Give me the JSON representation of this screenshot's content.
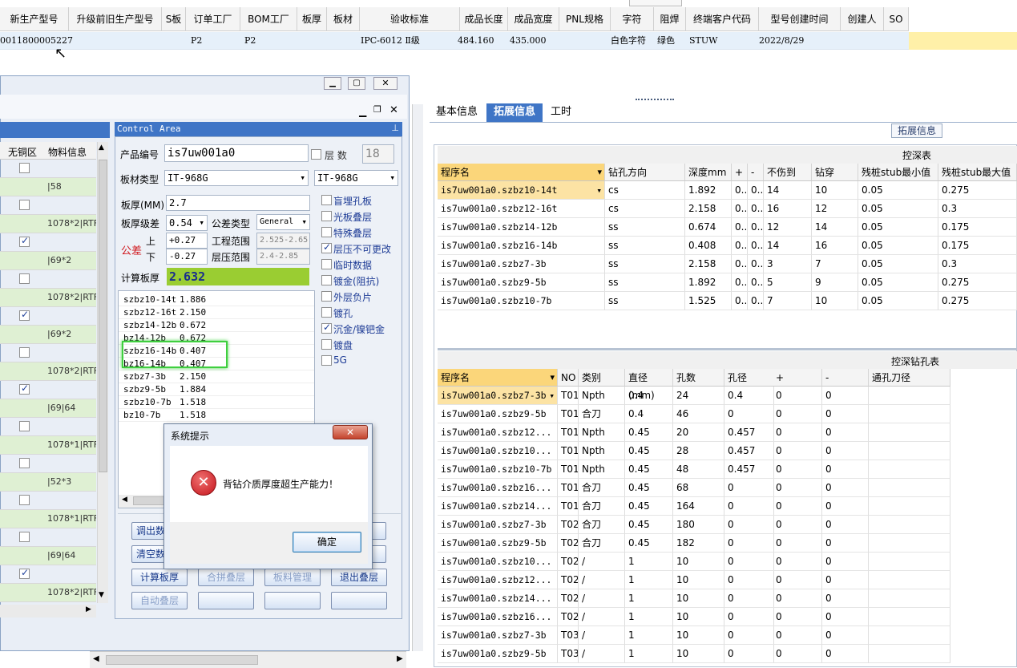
{
  "top_grid": {
    "headers": [
      "新生产型号",
      "升级前旧生产型号",
      "S板",
      "订单工厂",
      "BOM工厂",
      "板厚",
      "板材",
      "验收标准",
      "成品长度",
      "成品宽度",
      "PNL规格",
      "字符",
      "阻焊",
      "终端客户代码",
      "型号创建时间",
      "创建人",
      "SO"
    ],
    "row": {
      "model": "0011800005227",
      "s_board": "",
      "order_factory": "P2",
      "bom_factory": "P2",
      "thickness": "",
      "material": "",
      "standard": "IPC-6012 Ⅱ级",
      "length": "484.160",
      "width": "435.000",
      "pnl": "",
      "char": "白色字符",
      "mask": "绿色",
      "customer": "STUW",
      "created": "2022/8/29",
      "creator": "",
      "so": ""
    }
  },
  "left_list": {
    "headers": [
      "无铜区",
      "物料信息"
    ],
    "rows": [
      {
        "checked": false,
        "info": ""
      },
      {
        "checked": false,
        "info": "|58"
      },
      {
        "checked": false,
        "info": ""
      },
      {
        "checked": false,
        "info": "1078*2|RTF"
      },
      {
        "checked": true,
        "info": ""
      },
      {
        "checked": false,
        "info": "|69*2"
      },
      {
        "checked": false,
        "info": ""
      },
      {
        "checked": false,
        "info": "1078*2|RTF"
      },
      {
        "checked": true,
        "info": ""
      },
      {
        "checked": false,
        "info": "|69*2"
      },
      {
        "checked": false,
        "info": ""
      },
      {
        "checked": false,
        "info": "1078*2|RTF"
      },
      {
        "checked": true,
        "info": ""
      },
      {
        "checked": false,
        "info": "|69|64"
      },
      {
        "checked": false,
        "info": ""
      },
      {
        "checked": false,
        "info": "1078*1|RTF"
      },
      {
        "checked": false,
        "info": ""
      },
      {
        "checked": false,
        "info": "|52*3"
      },
      {
        "checked": false,
        "info": ""
      },
      {
        "checked": false,
        "info": "1078*1|RTF"
      },
      {
        "checked": false,
        "info": ""
      },
      {
        "checked": false,
        "info": "|69|64"
      },
      {
        "checked": true,
        "info": ""
      },
      {
        "checked": false,
        "info": "1078*2|RTF"
      }
    ]
  },
  "control_area": {
    "title": "Control Area",
    "product_label": "产品编号",
    "product_value": "is7uw001a0",
    "layers_label": "层 数",
    "layers_value": "18",
    "material_label": "板材类型",
    "material_value": "IT-968G",
    "material_value2": "IT-968G",
    "thickness_label": "板厚(MM)",
    "thickness_value": "2.7",
    "tol_level_label": "板厚级差",
    "tol_level_value": "0.54",
    "tol_type_label": "公差类型",
    "tol_type_value": "General",
    "tol_label": "公差",
    "upper_label": "上",
    "lower_label": "下",
    "upper_value": "+0.27",
    "lower_value": "-0.27",
    "eng_range_label": "工程范围",
    "eng_range_value": "2.525-2.65",
    "press_range_label": "层压范围",
    "press_range_value": "2.4-2.85",
    "calc_label": "计算板厚",
    "calc_value": "2.632",
    "options": [
      {
        "label": "盲埋孔板",
        "checked": false
      },
      {
        "label": "光板叠层",
        "checked": false
      },
      {
        "label": "特殊叠层",
        "checked": false
      },
      {
        "label": "层压不可更改",
        "checked": true
      },
      {
        "label": "临时数据",
        "checked": false
      },
      {
        "label": "镀金(阻抗)",
        "checked": false
      },
      {
        "label": "外层负片",
        "checked": false
      },
      {
        "label": "镀孔",
        "checked": false
      },
      {
        "label": "沉金/镍钯金",
        "checked": true
      },
      {
        "label": "镀盘",
        "checked": false
      },
      {
        "label": "5G",
        "checked": false
      }
    ],
    "list_rows": [
      {
        "name": "szbz10-14t",
        "val": "1.886"
      },
      {
        "name": "szbz12-16t",
        "val": "2.150"
      },
      {
        "name": "szbz14-12b",
        "val": "0.672"
      },
      {
        "name": "bz14-12b",
        "val": "0.672"
      },
      {
        "name": "szbz16-14b",
        "val": "0.407"
      },
      {
        "name": "bz16-14b",
        "val": "0.407"
      },
      {
        "name": "szbz7-3b",
        "val": "2.150"
      },
      {
        "name": "szbz9-5b",
        "val": "1.884"
      },
      {
        "name": "szbz10-7b",
        "val": "1.518"
      },
      {
        "name": "bz10-7b",
        "val": "1.518"
      }
    ],
    "buttons": {
      "export": "调出数",
      "clear": "清空数",
      "calc": "计算板厚",
      "merge": "合拼叠层",
      "material_mgmt": "板料管理",
      "exit": "退出叠层",
      "auto": "自动叠层"
    }
  },
  "dialog": {
    "title": "系统提示",
    "message": "背钻介质厚度超生产能力！",
    "ok": "确定"
  },
  "right_panel": {
    "tabs": [
      "基本信息",
      "拓展信息",
      "工时"
    ],
    "active_tab": "拓展信息",
    "groupbox_label": "拓展信息",
    "depth_table": {
      "caption": "控深表",
      "headers": [
        "程序名",
        "钻孔方向",
        "深度mm",
        "+",
        "-",
        "不伤到",
        "钻穿",
        "残桩stub最小值",
        "残桩stub最大值"
      ],
      "rows": [
        [
          "is7uw001a0.szbz10-14t",
          "cs",
          "1.892",
          "0..",
          "0..",
          "14",
          "10",
          "0.05",
          "0.275"
        ],
        [
          "is7uw001a0.szbz12-16t",
          "cs",
          "2.158",
          "0..",
          "0..",
          "16",
          "12",
          "0.05",
          "0.3"
        ],
        [
          "is7uw001a0.szbz14-12b",
          "ss",
          "0.674",
          "0..",
          "0..",
          "12",
          "14",
          "0.05",
          "0.175"
        ],
        [
          "is7uw001a0.szbz16-14b",
          "ss",
          "0.408",
          "0..",
          "0..",
          "14",
          "16",
          "0.05",
          "0.175"
        ],
        [
          "is7uw001a0.szbz7-3b",
          "ss",
          "2.158",
          "0..",
          "0..",
          "3",
          "7",
          "0.05",
          "0.3"
        ],
        [
          "is7uw001a0.szbz9-5b",
          "ss",
          "1.892",
          "0..",
          "0..",
          "5",
          "9",
          "0.05",
          "0.275"
        ],
        [
          "is7uw001a0.szbz10-7b",
          "ss",
          "1.525",
          "0..",
          "0..",
          "7",
          "10",
          "0.05",
          "0.275"
        ]
      ]
    },
    "hole_table": {
      "caption": "控深钻孔表",
      "headers": [
        "程序名",
        "NO",
        "类别",
        "直径(mm)",
        "孔数",
        "孔径",
        "+",
        "-",
        "通孔刀径"
      ],
      "rows": [
        [
          "is7uw001a0.szbz7-3b",
          "T01",
          "Npth",
          "0.4",
          "24",
          "0.4",
          "0",
          "0",
          ""
        ],
        [
          "is7uw001a0.szbz9-5b",
          "T01",
          "合刀",
          "0.4",
          "46",
          "0",
          "0",
          "0",
          ""
        ],
        [
          "is7uw001a0.szbz12...",
          "T01",
          "Npth",
          "0.45",
          "20",
          "0.457",
          "0",
          "0",
          ""
        ],
        [
          "is7uw001a0.szbz10...",
          "T01",
          "Npth",
          "0.45",
          "28",
          "0.457",
          "0",
          "0",
          ""
        ],
        [
          "is7uw001a0.szbz10-7b",
          "T01",
          "Npth",
          "0.45",
          "48",
          "0.457",
          "0",
          "0",
          ""
        ],
        [
          "is7uw001a0.szbz16...",
          "T01",
          "合刀",
          "0.45",
          "68",
          "0",
          "0",
          "0",
          ""
        ],
        [
          "is7uw001a0.szbz14...",
          "T01",
          "合刀",
          "0.45",
          "164",
          "0",
          "0",
          "0",
          ""
        ],
        [
          "is7uw001a0.szbz7-3b",
          "T02",
          "合刀",
          "0.45",
          "180",
          "0",
          "0",
          "0",
          ""
        ],
        [
          "is7uw001a0.szbz9-5b",
          "T02",
          "合刀",
          "0.45",
          "182",
          "0",
          "0",
          "0",
          ""
        ],
        [
          "is7uw001a0.szbz10...",
          "T02",
          "/",
          "1",
          "10",
          "0",
          "0",
          "0",
          ""
        ],
        [
          "is7uw001a0.szbz12...",
          "T02",
          "/",
          "1",
          "10",
          "0",
          "0",
          "0",
          ""
        ],
        [
          "is7uw001a0.szbz14...",
          "T02",
          "/",
          "1",
          "10",
          "0",
          "0",
          "0",
          ""
        ],
        [
          "is7uw001a0.szbz16...",
          "T02",
          "/",
          "1",
          "10",
          "0",
          "0",
          "0",
          ""
        ],
        [
          "is7uw001a0.szbz7-3b",
          "T03",
          "/",
          "1",
          "10",
          "0",
          "0",
          "0",
          ""
        ],
        [
          "is7uw001a0.szbz9-5b",
          "T03",
          "/",
          "1",
          "10",
          "0",
          "0",
          "0",
          ""
        ]
      ]
    }
  },
  "colors": {
    "accent": "#3f75c6",
    "selection": "#fce3a4",
    "green_row": "#dff0d3",
    "calc_bg": "#9acd32",
    "error": "#d0171d"
  }
}
